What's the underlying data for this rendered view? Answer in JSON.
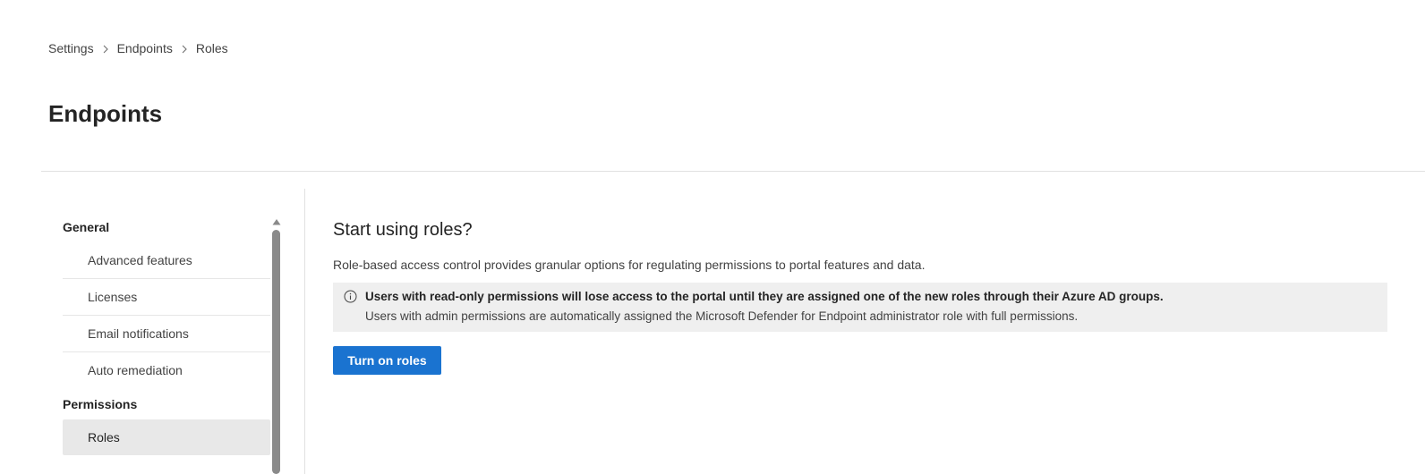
{
  "breadcrumb": {
    "items": [
      "Settings",
      "Endpoints",
      "Roles"
    ]
  },
  "page": {
    "title": "Endpoints"
  },
  "sidebar": {
    "groups": [
      {
        "label": "General",
        "items": [
          "Advanced features",
          "Licenses",
          "Email notifications",
          "Auto remediation"
        ]
      },
      {
        "label": "Permissions",
        "items": [
          "Roles"
        ]
      }
    ],
    "selected": "Roles"
  },
  "main": {
    "title": "Start using roles?",
    "description": "Role-based access control provides granular options for regulating permissions to portal features and data.",
    "info": {
      "icon": "info-icon",
      "bold": "Users with read-only permissions will lose access to the portal until they are assigned one of the new roles through their Azure AD groups.",
      "text": "Users with admin permissions are automatically assigned the Microsoft Defender for Endpoint administrator role with full permissions."
    },
    "button_label": "Turn on roles"
  },
  "colors": {
    "accent": "#1a73d0",
    "info_background": "#efefef",
    "selected_background": "#e8e8e8"
  }
}
